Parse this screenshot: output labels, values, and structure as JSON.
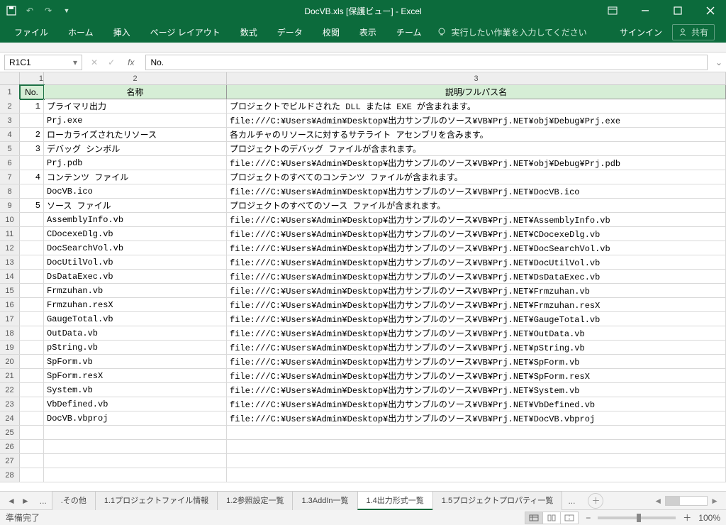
{
  "window": {
    "title": "DocVB.xls  [保護ビュー] - Excel"
  },
  "ribbon": {
    "tabs": [
      "ファイル",
      "ホーム",
      "挿入",
      "ページ レイアウト",
      "数式",
      "データ",
      "校閲",
      "表示",
      "チーム"
    ],
    "tellme": "実行したい作業を入力してください",
    "signin": "サインイン",
    "share": "共有"
  },
  "namebox": "R1C1",
  "fx_value": "No.",
  "col_headers": [
    "1",
    "2",
    "3"
  ],
  "header_row": {
    "no": "No.",
    "name": "名称",
    "desc": "説明/フルパス名"
  },
  "rows": [
    {
      "rh": "1",
      "no": "1",
      "name": "プライマリ出力",
      "desc": "プロジェクトでビルドされた DLL または EXE が含まれます。"
    },
    {
      "rh": "2",
      "no": "",
      "name": "Prj.exe",
      "desc": "file:///C:¥Users¥Admin¥Desktop¥出力サンプルのソース¥VB¥Prj.NET¥obj¥Debug¥Prj.exe"
    },
    {
      "rh": "3",
      "no": "2",
      "name": "ローカライズされたリソース",
      "desc": "各カルチャのリソースに対するサテライト アセンブリを含みます。"
    },
    {
      "rh": "4",
      "no": "3",
      "name": "デバッグ シンボル",
      "desc": "プロジェクトのデバッグ ファイルが含まれます。"
    },
    {
      "rh": "5",
      "no": "",
      "name": "Prj.pdb",
      "desc": "file:///C:¥Users¥Admin¥Desktop¥出力サンプルのソース¥VB¥Prj.NET¥obj¥Debug¥Prj.pdb"
    },
    {
      "rh": "6",
      "no": "4",
      "name": "コンテンツ ファイル",
      "desc": "プロジェクトのすべてのコンテンツ ファイルが含まれます。"
    },
    {
      "rh": "7",
      "no": "",
      "name": "DocVB.ico",
      "desc": "file:///C:¥Users¥Admin¥Desktop¥出力サンプルのソース¥VB¥Prj.NET¥DocVB.ico"
    },
    {
      "rh": "8",
      "no": "5",
      "name": "ソース ファイル",
      "desc": "プロジェクトのすべてのソース ファイルが含まれます。"
    },
    {
      "rh": "9",
      "no": "",
      "name": "AssemblyInfo.vb",
      "desc": "file:///C:¥Users¥Admin¥Desktop¥出力サンプルのソース¥VB¥Prj.NET¥AssemblyInfo.vb"
    },
    {
      "rh": "10",
      "no": "",
      "name": "CDocexeDlg.vb",
      "desc": "file:///C:¥Users¥Admin¥Desktop¥出力サンプルのソース¥VB¥Prj.NET¥CDocexeDlg.vb"
    },
    {
      "rh": "11",
      "no": "",
      "name": "DocSearchVol.vb",
      "desc": "file:///C:¥Users¥Admin¥Desktop¥出力サンプルのソース¥VB¥Prj.NET¥DocSearchVol.vb"
    },
    {
      "rh": "12",
      "no": "",
      "name": "DocUtilVol.vb",
      "desc": "file:///C:¥Users¥Admin¥Desktop¥出力サンプルのソース¥VB¥Prj.NET¥DocUtilVol.vb"
    },
    {
      "rh": "13",
      "no": "",
      "name": "DsDataExec.vb",
      "desc": "file:///C:¥Users¥Admin¥Desktop¥出力サンプルのソース¥VB¥Prj.NET¥DsDataExec.vb"
    },
    {
      "rh": "14",
      "no": "",
      "name": "Frmzuhan.vb",
      "desc": "file:///C:¥Users¥Admin¥Desktop¥出力サンプルのソース¥VB¥Prj.NET¥Frmzuhan.vb"
    },
    {
      "rh": "15",
      "no": "",
      "name": "Frmzuhan.resX",
      "desc": "file:///C:¥Users¥Admin¥Desktop¥出力サンプルのソース¥VB¥Prj.NET¥Frmzuhan.resX"
    },
    {
      "rh": "16",
      "no": "",
      "name": "GaugeTotal.vb",
      "desc": "file:///C:¥Users¥Admin¥Desktop¥出力サンプルのソース¥VB¥Prj.NET¥GaugeTotal.vb"
    },
    {
      "rh": "17",
      "no": "",
      "name": "OutData.vb",
      "desc": "file:///C:¥Users¥Admin¥Desktop¥出力サンプルのソース¥VB¥Prj.NET¥OutData.vb"
    },
    {
      "rh": "18",
      "no": "",
      "name": "pString.vb",
      "desc": "file:///C:¥Users¥Admin¥Desktop¥出力サンプルのソース¥VB¥Prj.NET¥pString.vb"
    },
    {
      "rh": "19",
      "no": "",
      "name": "SpForm.vb",
      "desc": "file:///C:¥Users¥Admin¥Desktop¥出力サンプルのソース¥VB¥Prj.NET¥SpForm.vb"
    },
    {
      "rh": "20",
      "no": "",
      "name": "SpForm.resX",
      "desc": "file:///C:¥Users¥Admin¥Desktop¥出力サンプルのソース¥VB¥Prj.NET¥SpForm.resX"
    },
    {
      "rh": "21",
      "no": "",
      "name": "System.vb",
      "desc": "file:///C:¥Users¥Admin¥Desktop¥出力サンプルのソース¥VB¥Prj.NET¥System.vb"
    },
    {
      "rh": "22",
      "no": "",
      "name": "VbDefined.vb",
      "desc": "file:///C:¥Users¥Admin¥Desktop¥出力サンプルのソース¥VB¥Prj.NET¥VbDefined.vb"
    },
    {
      "rh": "23",
      "no": "",
      "name": "DocVB.vbproj",
      "desc": "file:///C:¥Users¥Admin¥Desktop¥出力サンプルのソース¥VB¥Prj.NET¥DocVB.vbproj"
    },
    {
      "rh": "24",
      "no": "",
      "name": "",
      "desc": ""
    },
    {
      "rh": "25",
      "no": "",
      "name": "",
      "desc": ""
    },
    {
      "rh": "26",
      "no": "",
      "name": "",
      "desc": ""
    },
    {
      "rh": "27",
      "no": "",
      "name": "",
      "desc": ""
    }
  ],
  "sheet_tabs": [
    {
      "label": ".その他",
      "active": false
    },
    {
      "label": "1.1プロジェクトファイル情報",
      "active": false
    },
    {
      "label": "1.2参照設定一覧",
      "active": false
    },
    {
      "label": "1.3AddIn一覧",
      "active": false
    },
    {
      "label": "1.4出力形式一覧",
      "active": true
    },
    {
      "label": "1.5プロジェクトプロパティ一覧",
      "active": false
    }
  ],
  "status": {
    "ready": "準備完了",
    "zoom": "100%"
  }
}
